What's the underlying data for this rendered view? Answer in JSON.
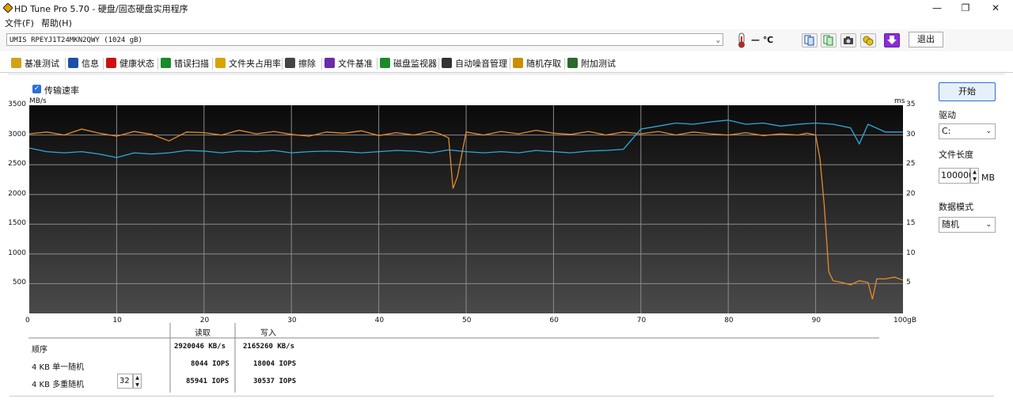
{
  "window": {
    "title": "HD Tune Pro 5.70 - 硬盘/固态硬盘实用程序",
    "min": "—",
    "max": "❐",
    "close": "✕"
  },
  "menu": {
    "file": "文件(F)",
    "help": "帮助(H)"
  },
  "drive": {
    "selected": "UMIS RPEYJ1T24MKN2QWY (1024 gB)",
    "temperature": "— ℃"
  },
  "toolbar": {
    "exit_label": "退出"
  },
  "tabs": [
    {
      "label": "基准测试",
      "icon": "bulb-icon",
      "color": "#d4a017"
    },
    {
      "label": "信息",
      "icon": "info-icon",
      "color": "#1d4fa8"
    },
    {
      "label": "健康状态",
      "icon": "health-cross-icon",
      "color": "#cc1010"
    },
    {
      "label": "错误扫描",
      "icon": "magnifier-icon",
      "color": "#1a8a2a"
    },
    {
      "label": "文件夹占用率",
      "icon": "folder-icon",
      "color": "#d9a300"
    },
    {
      "label": "擦除",
      "icon": "trash-icon",
      "color": "#444444"
    },
    {
      "label": "文件基准",
      "icon": "file-benchmark-icon",
      "color": "#6a2ca8"
    },
    {
      "label": "磁盘监视器",
      "icon": "monitor-chart-icon",
      "color": "#1d8a2a"
    },
    {
      "label": "自动噪音管理",
      "icon": "speaker-icon",
      "color": "#333333"
    },
    {
      "label": "随机存取",
      "icon": "random-access-icon",
      "color": "#c89000"
    },
    {
      "label": "附加测试",
      "icon": "extra-test-icon",
      "color": "#2a6a2a"
    }
  ],
  "panel": {
    "transfer_rate_label": "传输速率",
    "start_button": "开始",
    "drive_label": "驱动",
    "drive_value": "C:",
    "file_length_label": "文件长度",
    "file_length_value": "100000",
    "file_length_unit": "MB",
    "data_mode_label": "数据模式",
    "data_mode_value": "随机"
  },
  "results": {
    "read_header": "读取",
    "write_header": "写入",
    "rows": [
      {
        "label": "顺序",
        "read": "2920046 KB/s",
        "write": "2165260 KB/s"
      },
      {
        "label": "4 KB 单一随机",
        "read": "8044 IOPS",
        "write": "18004 IOPS"
      },
      {
        "label": "4 KB 多重随机",
        "read": "85941 IOPS",
        "write": "30537 IOPS"
      }
    ],
    "queue_depth": "32"
  },
  "chart_data": {
    "type": "line",
    "left_unit": "MB/s",
    "right_unit": "ms",
    "x_unit": "100gB",
    "xlim": [
      0,
      100
    ],
    "ylim_left": [
      0,
      3500
    ],
    "ylim_right": [
      0,
      35
    ],
    "xticks": [
      "0",
      "10",
      "20",
      "30",
      "40",
      "50",
      "60",
      "70",
      "80",
      "90"
    ],
    "yticks_left": [
      "3500",
      "3000",
      "2500",
      "2000",
      "1500",
      "1000",
      "500"
    ],
    "yticks_right": [
      "35",
      "30",
      "25",
      "20",
      "15",
      "10",
      "5"
    ],
    "grid": true,
    "colors": {
      "write": "#e8892b",
      "read": "#2fa8e0",
      "bg_top": "#0a0a0a",
      "bg_bottom": "#4a4a4a",
      "grid": "#8c8c8c"
    },
    "series": [
      {
        "key": "write",
        "x": [
          0,
          2,
          4,
          6,
          8,
          10,
          12,
          14,
          16,
          18,
          20,
          22,
          24,
          26,
          28,
          30,
          32,
          34,
          36,
          38,
          40,
          42,
          44,
          46,
          47,
          48,
          48.5,
          49,
          50,
          52,
          54,
          56,
          58,
          60,
          62,
          64,
          66,
          68,
          70,
          72,
          74,
          76,
          78,
          80,
          82,
          84,
          86,
          88,
          89,
          90,
          90.5,
          91,
          91.5,
          92,
          93,
          94,
          95,
          96,
          96.5,
          97,
          98,
          99,
          100
        ],
        "y": [
          3020,
          3050,
          3000,
          3100,
          3030,
          2980,
          3060,
          3010,
          2900,
          3050,
          3040,
          3000,
          3080,
          3020,
          3060,
          3010,
          2980,
          3050,
          3030,
          3070,
          2990,
          3040,
          3000,
          3060,
          3020,
          2950,
          2100,
          2300,
          3050,
          3000,
          3060,
          3020,
          3080,
          3030,
          3010,
          3060,
          3000,
          3050,
          3020,
          3060,
          3000,
          3050,
          3020,
          3000,
          3040,
          2990,
          3020,
          3000,
          3030,
          3000,
          2600,
          1800,
          700,
          550,
          520,
          480,
          550,
          520,
          240,
          580,
          580,
          610,
          560
        ]
      },
      {
        "key": "read",
        "x": [
          0,
          2,
          4,
          6,
          8,
          10,
          12,
          14,
          16,
          18,
          20,
          22,
          24,
          26,
          28,
          30,
          32,
          34,
          36,
          38,
          40,
          42,
          44,
          46,
          48,
          50,
          52,
          54,
          56,
          58,
          60,
          62,
          64,
          66,
          68,
          70,
          72,
          74,
          76,
          78,
          80,
          82,
          84,
          86,
          88,
          90,
          92,
          94,
          95,
          96,
          98,
          100
        ],
        "y": [
          2780,
          2720,
          2700,
          2720,
          2680,
          2620,
          2700,
          2680,
          2700,
          2740,
          2730,
          2700,
          2730,
          2720,
          2740,
          2700,
          2720,
          2730,
          2720,
          2700,
          2720,
          2740,
          2730,
          2700,
          2750,
          2720,
          2700,
          2720,
          2700,
          2740,
          2720,
          2700,
          2730,
          2740,
          2760,
          3100,
          3150,
          3200,
          3180,
          3220,
          3250,
          3180,
          3200,
          3150,
          3180,
          3200,
          3180,
          3120,
          2850,
          3180,
          3050,
          3050
        ]
      }
    ]
  }
}
